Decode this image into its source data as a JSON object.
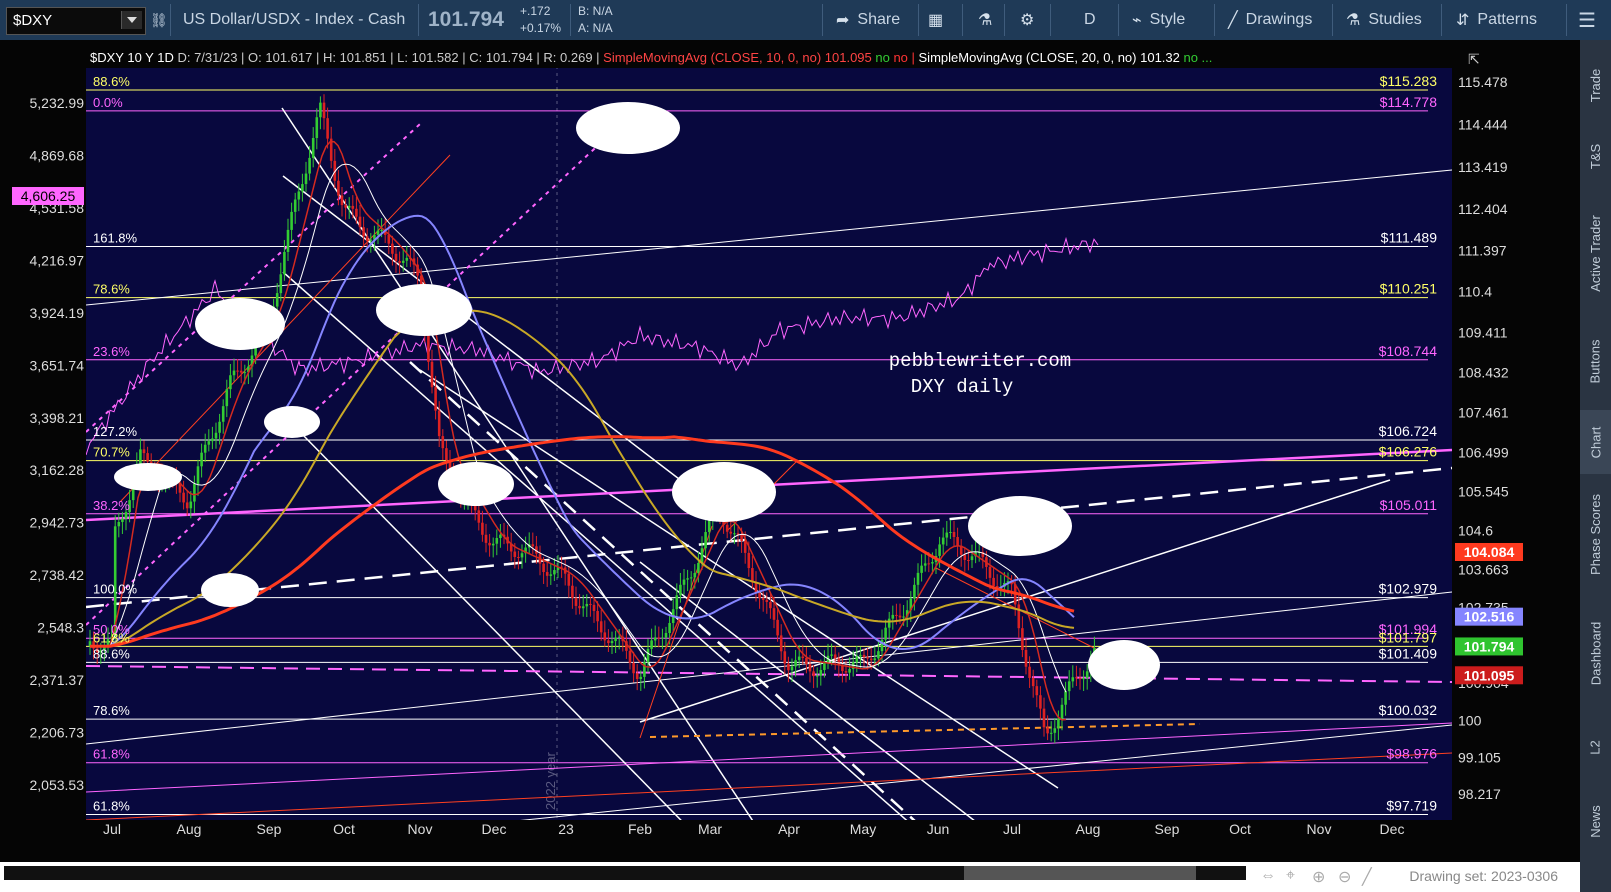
{
  "toolbar": {
    "symbol": "$DXY",
    "description": "US Dollar/USDX - Index - Cash",
    "last": "101.794",
    "change": "+.172",
    "change_pct": "+0.17%",
    "bid": "B: N/A",
    "ask": "A: N/A",
    "share": "Share",
    "aggregation": "D",
    "style": "Style",
    "drawings": "Drawings",
    "studies": "Studies",
    "patterns": "Patterns"
  },
  "side_tabs": [
    "Trade",
    "T&S",
    "Active Trader",
    "Buttons",
    "Chart",
    "Phase Scores",
    "Dashboard",
    "L2",
    "News"
  ],
  "bottom": {
    "drawing_set": "Drawing set: 2023-0306"
  },
  "colors": {
    "background": "#08083e",
    "up_candle": "#33cc33",
    "down_candle": "#dd2222",
    "sma10": "#d42a20",
    "sma20": "#ffffff",
    "sma50": "#8585ff",
    "sma100": "#c8a826",
    "sma200": "#ff3a1f",
    "magenta": "#ff66ff",
    "yellow": "#ffff66",
    "white": "#ffffff"
  },
  "chart_data": {
    "type": "line",
    "title": "$DXY 10 Y 1D",
    "ohlc": {
      "date": "7/31/23",
      "open": "101.617",
      "high": "101.851",
      "low": "101.582",
      "close": "101.794",
      "range": "0.269"
    },
    "studies": [
      {
        "label": "SimpleMovingAvg (CLOSE, 10, 0, no)",
        "value": "101.095",
        "flags": [
          "no",
          "no"
        ]
      },
      {
        "label": "SimpleMovingAvg (CLOSE, 20, 0, no)",
        "value": "101.32",
        "flags": [
          "no"
        ]
      }
    ],
    "watermark": [
      "pebblewriter.com",
      "DXY daily"
    ],
    "year_marker": "2022 year",
    "x_labels": [
      "Jul",
      "Aug",
      "Sep",
      "Oct",
      "Nov",
      "Dec",
      "23",
      "Feb",
      "Mar",
      "Apr",
      "May",
      "Jun",
      "Jul",
      "Aug",
      "Sep",
      "Oct",
      "Nov",
      "Dec"
    ],
    "y_right": {
      "range": [
        97.6,
        115.8
      ],
      "ticks": [
        "115.478",
        "114.444",
        "113.419",
        "112.404",
        "111.397",
        "110.4",
        "109.411",
        "108.432",
        "107.461",
        "106.499",
        "105.545",
        "104.6",
        "103.663",
        "102.735",
        "101.815",
        "100.904",
        "100",
        "99.105",
        "98.217"
      ],
      "tick_values": [
        115.478,
        114.444,
        113.419,
        112.404,
        111.397,
        110.4,
        109.411,
        108.432,
        107.461,
        106.499,
        105.545,
        104.6,
        103.663,
        102.735,
        101.815,
        100.904,
        100,
        99.105,
        98.217
      ]
    },
    "y_left": {
      "ticks": [
        "5,232.99",
        "4,869.68",
        "4,531.58",
        "4,216.97",
        "3,924.19",
        "3,651.74",
        "3,398.21",
        "3,162.28",
        "2,942.73",
        "2,738.42",
        "2,548.3",
        "2,371.37",
        "2,206.73",
        "2,053.53"
      ],
      "tick_values": [
        5232.99,
        4869.68,
        4531.58,
        4216.97,
        3924.19,
        3651.74,
        3398.21,
        3162.28,
        2942.73,
        2738.42,
        2548.3,
        2371.37,
        2206.73,
        2053.53
      ],
      "badge": "4,606.25"
    },
    "price_badges": [
      {
        "label": "104.084",
        "value": 104.084,
        "color": "#ff3a1f"
      },
      {
        "label": "102.516",
        "value": 102.516,
        "color": "#8585ff"
      },
      {
        "label": "101.794",
        "value": 101.794,
        "color": "#2fc42f"
      },
      {
        "label": "101.095",
        "value": 101.095,
        "color": "#cc1c1c"
      }
    ],
    "levels": [
      {
        "pct": "88.6%",
        "price": "$115.283",
        "value": 115.283,
        "color": "#ffff66"
      },
      {
        "pct": "0.0%",
        "price": "$114.778",
        "value": 114.778,
        "color": "#ff66ff"
      },
      {
        "pct": "161.8%",
        "price": "$111.489",
        "value": 111.489,
        "color": "#ffffff"
      },
      {
        "pct": "78.6%",
        "price": "$110.251",
        "value": 110.251,
        "color": "#ffff66"
      },
      {
        "pct": "23.6%",
        "price": "$108.744",
        "value": 108.744,
        "color": "#ff66ff"
      },
      {
        "pct": "127.2%",
        "price": "$106.724",
        "value": 106.8,
        "color": "#ffffff"
      },
      {
        "pct": "70.7%",
        "price": "$106.276",
        "value": 106.3,
        "color": "#ffff66"
      },
      {
        "pct": "38.2%",
        "price": "$105.011",
        "value": 105.011,
        "color": "#ff66ff"
      },
      {
        "pct": "100.0%",
        "price": "$102.979",
        "value": 102.979,
        "color": "#ffffff"
      },
      {
        "pct": "50.0%",
        "price": "$101.994",
        "value": 101.994,
        "color": "#ff66ff"
      },
      {
        "pct": "61.8%",
        "price": "$101.797",
        "value": 101.797,
        "color": "#ffff66"
      },
      {
        "pct": "88.6%",
        "price": "$101.409",
        "value": 101.409,
        "color": "#ffffff"
      },
      {
        "pct": "78.6%",
        "price": "$100.032",
        "value": 100.032,
        "color": "#ffffff"
      },
      {
        "pct": "61.8%",
        "price": "$98.976",
        "value": 98.976,
        "color": "#ff66ff"
      },
      {
        "pct": "61.8%",
        "price": "$97.719",
        "value": 97.719,
        "color": "#ffffff"
      }
    ],
    "price_path": [
      [
        "Jul",
        104.3
      ],
      [
        "Jul",
        106.5
      ],
      [
        "Aug",
        105.2
      ],
      [
        "Aug",
        108.2
      ],
      [
        "Sep",
        109.8
      ],
      [
        "Sep",
        114.7
      ],
      [
        "Oct",
        112.5
      ],
      [
        "Oct",
        111.5
      ],
      [
        "Nov",
        110.5
      ],
      [
        "Nov",
        106.5
      ],
      [
        "Dec",
        104.3
      ],
      [
        "23",
        103.5
      ],
      [
        "Feb",
        101.0
      ],
      [
        "Mar",
        105.2
      ],
      [
        "Apr",
        101.5
      ],
      [
        "May",
        101.2
      ],
      [
        "Jun",
        104.4
      ],
      [
        "Jul",
        103.2
      ],
      [
        "Jul",
        99.6
      ],
      [
        "Aug",
        101.8
      ]
    ]
  }
}
